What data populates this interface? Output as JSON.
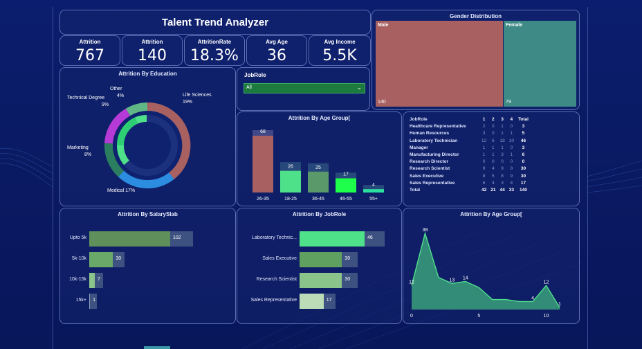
{
  "title": "Talent Trend Analyzer",
  "kpis": [
    {
      "label": "Attrition",
      "value": "767"
    },
    {
      "label": "Attrition",
      "value": "140"
    },
    {
      "label": "AttritionRate",
      "value": "18.3%"
    },
    {
      "label": "Avg Age",
      "value": "36"
    },
    {
      "label": "Avg Income",
      "value": "5.5K"
    }
  ],
  "gender": {
    "title": "Gender Distribution",
    "male_label": "Male",
    "male_value": "140",
    "female_label": "Female",
    "female_value": "79",
    "male_color": "#a86160",
    "female_color": "#3e8a86"
  },
  "education": {
    "title": "Attrition By Education",
    "slices": [
      {
        "label": "Life Sciences",
        "pct": "19%",
        "color": "#a86160"
      },
      {
        "label": "Medical 17%",
        "pct": "",
        "color": "#2b8ce0"
      },
      {
        "label": "Marketing",
        "pct": "8%",
        "color": "#2a7d5e"
      },
      {
        "label": "Technical Degree",
        "pct": "9%",
        "color": "#b53ad6"
      },
      {
        "label": "Other",
        "pct": "4%",
        "color": "#5fb886"
      }
    ]
  },
  "jobrole_filter": {
    "label": "JobRole",
    "value": "All"
  },
  "age_group_bar": {
    "title": "Attrition By Age Group[",
    "categories": [
      "26-35",
      "18-25",
      "36-45",
      "46-55",
      "55+"
    ],
    "values": [
      68,
      26,
      25,
      17,
      4
    ]
  },
  "matrix": {
    "headers": [
      "JobRole",
      "1",
      "2",
      "3",
      "4",
      "Total"
    ],
    "rows": [
      [
        "Healthcare Representative",
        "2",
        "0",
        "1",
        "0",
        "3"
      ],
      [
        "Human Resources",
        "3",
        "0",
        "1",
        "1",
        "5"
      ],
      [
        "Laboratory Technician",
        "12",
        "6",
        "18",
        "10",
        "46"
      ],
      [
        "Manager",
        "1",
        "1",
        "1",
        "0",
        "3"
      ],
      [
        "Manufacturing Director",
        "1",
        "1",
        "3",
        "1",
        "6"
      ],
      [
        "Research Director",
        "0",
        "0",
        "0",
        "0",
        "0"
      ],
      [
        "Research Scientist",
        "9",
        "4",
        "9",
        "8",
        "30"
      ],
      [
        "Sales Executive",
        "8",
        "5",
        "8",
        "9",
        "30"
      ],
      [
        "Sales Representative",
        "6",
        "4",
        "3",
        "4",
        "17"
      ]
    ],
    "total": [
      "Total",
      "42",
      "21",
      "44",
      "33",
      "140"
    ]
  },
  "salary": {
    "title": "Attrition By SalarySlab",
    "categories": [
      "Upto 5k",
      "5k-10k",
      "10k-15k",
      "15k+"
    ],
    "values": [
      102,
      30,
      7,
      1
    ]
  },
  "jobrole_bar": {
    "title": "Attrition By JobRole",
    "categories": [
      "Laboratory Technic...",
      "Sales Executive",
      "Research Scientist",
      "Sales Representative"
    ],
    "values": [
      46,
      30,
      30,
      17
    ]
  },
  "chart_data": [
    {
      "type": "bar",
      "title": "Attrition By Age Group[",
      "categories": [
        "26-35",
        "18-25",
        "36-45",
        "46-55",
        "55+"
      ],
      "values": [
        68,
        26,
        25,
        17,
        4
      ]
    },
    {
      "type": "bar",
      "title": "Attrition By SalarySlab",
      "categories": [
        "Upto 5k",
        "5k-10k",
        "10k-15k",
        "15k+"
      ],
      "values": [
        102,
        30,
        7,
        1
      ]
    },
    {
      "type": "bar",
      "title": "Attrition By JobRole",
      "categories": [
        "Laboratory Technic...",
        "Sales Executive",
        "Research Scientist",
        "Sales Representative"
      ],
      "values": [
        46,
        30,
        30,
        17
      ]
    },
    {
      "type": "area",
      "title": "Attrition By Age Group[",
      "x": [
        0,
        1,
        2,
        3,
        4,
        5,
        6,
        7,
        8,
        9,
        10,
        11
      ],
      "y": [
        12,
        38,
        16,
        13,
        14,
        11,
        5,
        5,
        4,
        4,
        12,
        1
      ],
      "labeled_points": [
        {
          "x": 0,
          "y": 12,
          "label": "12"
        },
        {
          "x": 1,
          "y": 38,
          "label": "38"
        },
        {
          "x": 3,
          "y": 13,
          "label": "13"
        },
        {
          "x": 4,
          "y": 14,
          "label": "14"
        },
        {
          "x": 9,
          "y": 4,
          "label": "4"
        },
        {
          "x": 10,
          "y": 12,
          "label": "12"
        },
        {
          "x": 11,
          "y": 1,
          "label": "1"
        }
      ],
      "xticks": [
        "0",
        "5",
        "10"
      ]
    },
    {
      "type": "pie",
      "title": "Attrition By Education",
      "labels": [
        "Life Sciences",
        "Medical",
        "Marketing",
        "Technical Degree",
        "Other"
      ],
      "values": [
        19,
        17,
        8,
        9,
        4
      ]
    }
  ]
}
